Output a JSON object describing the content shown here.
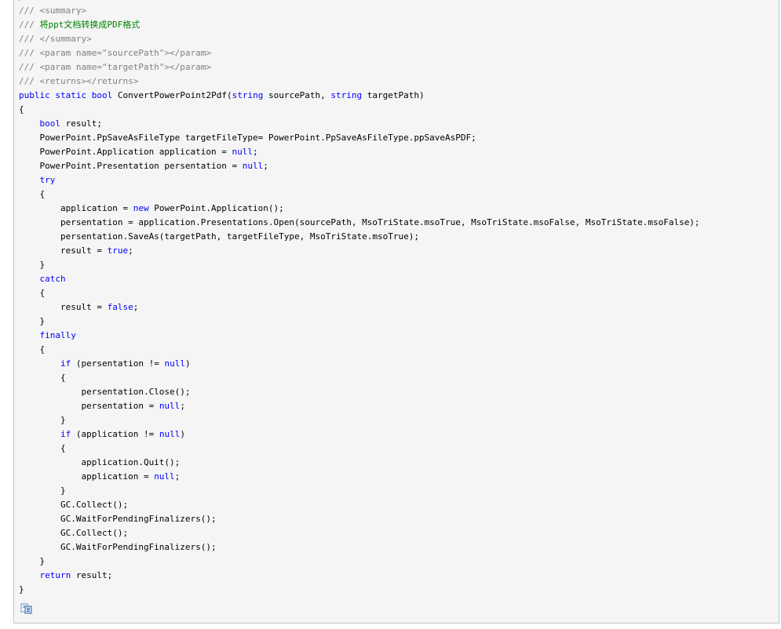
{
  "code_block": {
    "lines": [
      [
        {
          "t": "/// <summary>",
          "c": "comment"
        }
      ],
      [
        {
          "t": "/// ",
          "c": "comment"
        },
        {
          "t": "将ppt文档转换成PDF格式",
          "c": "comment-cn"
        }
      ],
      [
        {
          "t": "/// </summary>",
          "c": "comment"
        }
      ],
      [
        {
          "t": "/// <param name=\"sourcePath\"></param>",
          "c": "comment"
        }
      ],
      [
        {
          "t": "/// <param name=\"targetPath\"></param>",
          "c": "comment"
        }
      ],
      [
        {
          "t": "/// <returns></returns>",
          "c": "comment"
        }
      ],
      [
        {
          "t": "public",
          "c": "kw"
        },
        {
          "t": " ",
          "c": "plain"
        },
        {
          "t": "static",
          "c": "kw"
        },
        {
          "t": " ",
          "c": "plain"
        },
        {
          "t": "bool",
          "c": "kw"
        },
        {
          "t": " ConvertPowerPoint2Pdf(",
          "c": "plain"
        },
        {
          "t": "string",
          "c": "kw"
        },
        {
          "t": " sourcePath, ",
          "c": "plain"
        },
        {
          "t": "string",
          "c": "kw"
        },
        {
          "t": " targetPath)",
          "c": "plain"
        }
      ],
      [
        {
          "t": "{",
          "c": "plain"
        }
      ],
      [
        {
          "t": "    ",
          "c": "plain"
        },
        {
          "t": "bool",
          "c": "kw"
        },
        {
          "t": " result;",
          "c": "plain"
        }
      ],
      [
        {
          "t": "    PowerPoint.PpSaveAsFileType targetFileType= PowerPoint.PpSaveAsFileType.ppSaveAsPDF;",
          "c": "plain"
        }
      ],
      [
        {
          "t": "    PowerPoint.Application application = ",
          "c": "plain"
        },
        {
          "t": "null",
          "c": "lit"
        },
        {
          "t": ";",
          "c": "plain"
        }
      ],
      [
        {
          "t": "    PowerPoint.Presentation persentation = ",
          "c": "plain"
        },
        {
          "t": "null",
          "c": "lit"
        },
        {
          "t": ";",
          "c": "plain"
        }
      ],
      [
        {
          "t": "    ",
          "c": "plain"
        },
        {
          "t": "try",
          "c": "kw"
        }
      ],
      [
        {
          "t": "    {",
          "c": "plain"
        }
      ],
      [
        {
          "t": "        application = ",
          "c": "plain"
        },
        {
          "t": "new",
          "c": "kw"
        },
        {
          "t": " PowerPoint.Application();",
          "c": "plain"
        }
      ],
      [
        {
          "t": "        persentation = application.Presentations.Open(sourcePath, MsoTriState.msoTrue, MsoTriState.msoFalse, MsoTriState.msoFalse);",
          "c": "plain"
        }
      ],
      [
        {
          "t": "        persentation.SaveAs(targetPath, targetFileType, MsoTriState.msoTrue);",
          "c": "plain"
        }
      ],
      [
        {
          "t": "        result = ",
          "c": "plain"
        },
        {
          "t": "true",
          "c": "lit"
        },
        {
          "t": ";",
          "c": "plain"
        }
      ],
      [
        {
          "t": "    }",
          "c": "plain"
        }
      ],
      [
        {
          "t": "    ",
          "c": "plain"
        },
        {
          "t": "catch",
          "c": "kw"
        }
      ],
      [
        {
          "t": "    {",
          "c": "plain"
        }
      ],
      [
        {
          "t": "        result = ",
          "c": "plain"
        },
        {
          "t": "false",
          "c": "lit"
        },
        {
          "t": ";",
          "c": "plain"
        }
      ],
      [
        {
          "t": "    }",
          "c": "plain"
        }
      ],
      [
        {
          "t": "    ",
          "c": "plain"
        },
        {
          "t": "finally",
          "c": "kw"
        }
      ],
      [
        {
          "t": "    {",
          "c": "plain"
        }
      ],
      [
        {
          "t": "        ",
          "c": "plain"
        },
        {
          "t": "if",
          "c": "kw"
        },
        {
          "t": " (persentation != ",
          "c": "plain"
        },
        {
          "t": "null",
          "c": "lit"
        },
        {
          "t": ")",
          "c": "plain"
        }
      ],
      [
        {
          "t": "        {",
          "c": "plain"
        }
      ],
      [
        {
          "t": "            persentation.Close();",
          "c": "plain"
        }
      ],
      [
        {
          "t": "            persentation = ",
          "c": "plain"
        },
        {
          "t": "null",
          "c": "lit"
        },
        {
          "t": ";",
          "c": "plain"
        }
      ],
      [
        {
          "t": "        }",
          "c": "plain"
        }
      ],
      [
        {
          "t": "        ",
          "c": "plain"
        },
        {
          "t": "if",
          "c": "kw"
        },
        {
          "t": " (application != ",
          "c": "plain"
        },
        {
          "t": "null",
          "c": "lit"
        },
        {
          "t": ")",
          "c": "plain"
        }
      ],
      [
        {
          "t": "        {",
          "c": "plain"
        }
      ],
      [
        {
          "t": "            application.Quit();",
          "c": "plain"
        }
      ],
      [
        {
          "t": "            application = ",
          "c": "plain"
        },
        {
          "t": "null",
          "c": "lit"
        },
        {
          "t": ";",
          "c": "plain"
        }
      ],
      [
        {
          "t": "        }",
          "c": "plain"
        }
      ],
      [
        {
          "t": "        GC.Collect();",
          "c": "plain"
        }
      ],
      [
        {
          "t": "        GC.WaitForPendingFinalizers();",
          "c": "plain"
        }
      ],
      [
        {
          "t": "        GC.Collect();",
          "c": "plain"
        }
      ],
      [
        {
          "t": "        GC.WaitForPendingFinalizers();",
          "c": "plain"
        }
      ],
      [
        {
          "t": "    }",
          "c": "plain"
        }
      ],
      [
        {
          "t": "    ",
          "c": "plain"
        },
        {
          "t": "return",
          "c": "kw"
        },
        {
          "t": " result;",
          "c": "plain"
        }
      ],
      [
        {
          "t": "}",
          "c": "plain"
        }
      ]
    ]
  },
  "toolbar": {
    "copy_icon": "copy-code-icon"
  },
  "colors": {
    "panel_background": "#f5f5f5",
    "panel_border": "#c8c8c8",
    "comment": "#808080",
    "comment_chinese": "#008000",
    "keyword": "#0000ff",
    "text": "#000000"
  }
}
